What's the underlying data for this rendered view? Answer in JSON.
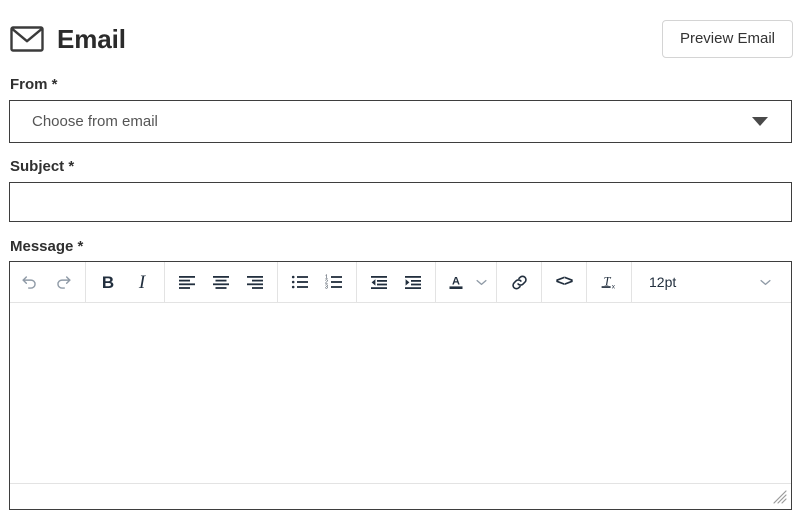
{
  "header": {
    "icon": "envelope-icon",
    "title": "Email",
    "preview_button": "Preview Email"
  },
  "form": {
    "from": {
      "label": "From *",
      "placeholder": "Choose from email",
      "value": "Choose from email",
      "caret_icon": "chevron-down-icon"
    },
    "subject": {
      "label": "Subject *",
      "value": "",
      "placeholder": ""
    },
    "message": {
      "label": "Message *",
      "body_value": ""
    }
  },
  "editor_toolbar": {
    "buttons": [
      {
        "name": "undo",
        "label": "↶",
        "icon": "undo-icon",
        "disabled": true
      },
      {
        "name": "redo",
        "label": "↷",
        "icon": "redo-icon",
        "disabled": true
      },
      {
        "name": "bold",
        "label": "B",
        "icon": "bold-icon",
        "disabled": false
      },
      {
        "name": "italic",
        "label": "I",
        "icon": "italic-icon",
        "disabled": false
      },
      {
        "name": "align-left",
        "label": "",
        "icon": "align-left-icon",
        "disabled": false
      },
      {
        "name": "align-center",
        "label": "",
        "icon": "align-center-icon",
        "disabled": false
      },
      {
        "name": "align-right",
        "label": "",
        "icon": "align-right-icon",
        "disabled": false
      },
      {
        "name": "bullet-list",
        "label": "",
        "icon": "bullet-list-icon",
        "disabled": false
      },
      {
        "name": "numbered-list",
        "label": "",
        "icon": "numbered-list-icon",
        "disabled": false
      },
      {
        "name": "outdent",
        "label": "",
        "icon": "outdent-icon",
        "disabled": false
      },
      {
        "name": "indent",
        "label": "",
        "icon": "indent-icon",
        "disabled": false
      },
      {
        "name": "text-color",
        "label": "A",
        "icon": "text-color-icon",
        "disabled": false
      },
      {
        "name": "text-color-menu",
        "label": "",
        "icon": "chevron-down-icon",
        "disabled": false
      },
      {
        "name": "insert-link",
        "label": "",
        "icon": "link-icon",
        "disabled": false
      },
      {
        "name": "source-code",
        "label": "<>",
        "icon": "source-code-icon",
        "disabled": false
      },
      {
        "name": "clear-formatting",
        "label": "",
        "icon": "clear-formatting-icon",
        "disabled": false
      }
    ],
    "fontsize": {
      "value": "12pt",
      "caret_icon": "chevron-down-icon"
    }
  },
  "statusbar": {
    "text": "",
    "resize_icon": "resize-grip-icon"
  },
  "colors": {
    "border_strong": "#3e3e3e",
    "border_light": "#e3e3e3",
    "button_border": "#d4d4d4",
    "icon": "#222f3e",
    "icon_disabled": "#8f9aa6",
    "text": "#222222",
    "placeholder": "#555555",
    "background": "#ffffff"
  }
}
